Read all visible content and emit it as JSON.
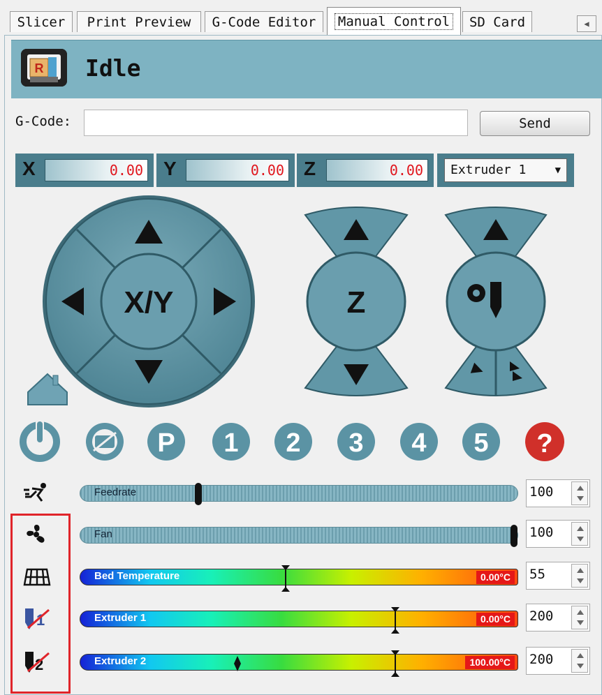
{
  "tabs": [
    {
      "label": "Slicer"
    },
    {
      "label": "Print Preview"
    },
    {
      "label": "G-Code Editor"
    },
    {
      "label": "Manual Control"
    },
    {
      "label": "SD Card"
    }
  ],
  "status": {
    "text": "Idle"
  },
  "gcode": {
    "label": "G-Code:",
    "value": "",
    "send_label": "Send"
  },
  "coords": [
    {
      "axis": "X",
      "value": "0.00"
    },
    {
      "axis": "Y",
      "value": "0.00"
    },
    {
      "axis": "Z",
      "value": "0.00"
    }
  ],
  "extruder_select": {
    "selected": "Extruder 1"
  },
  "jog": {
    "xy_label": "X/Y",
    "z_label": "Z"
  },
  "round_buttons": [
    {
      "icon": "power-icon"
    },
    {
      "icon": "motors-off-icon"
    },
    {
      "icon": "park-icon",
      "glyph": "P"
    },
    {
      "icon": "preset-1-icon",
      "glyph": "1"
    },
    {
      "icon": "preset-2-icon",
      "glyph": "2"
    },
    {
      "icon": "preset-3-icon",
      "glyph": "3"
    },
    {
      "icon": "preset-4-icon",
      "glyph": "4"
    },
    {
      "icon": "preset-5-icon",
      "glyph": "5"
    },
    {
      "icon": "help-icon",
      "glyph": "?"
    }
  ],
  "sliders": {
    "feedrate": {
      "label": "Feedrate",
      "value": "100",
      "level": 0.27
    },
    "fan": {
      "label": "Fan",
      "value": "100",
      "level": 1.0
    },
    "bed": {
      "label": "Bed Temperature",
      "reading": "0.00°C",
      "target": "55",
      "target_level": 0.47
    },
    "extruder1": {
      "label": "Extruder 1",
      "reading": "0.00°C",
      "target": "200",
      "target_level": 0.72
    },
    "extruder2": {
      "label": "Extruder 2",
      "reading": "100.00°C",
      "target": "200",
      "target_level": 0.72,
      "current_level": 0.36
    }
  },
  "colors": {
    "status_bar": "#7eb3c2",
    "control": "#5e93a3",
    "highlight": "#e0242a",
    "readout": "#e0151c"
  }
}
